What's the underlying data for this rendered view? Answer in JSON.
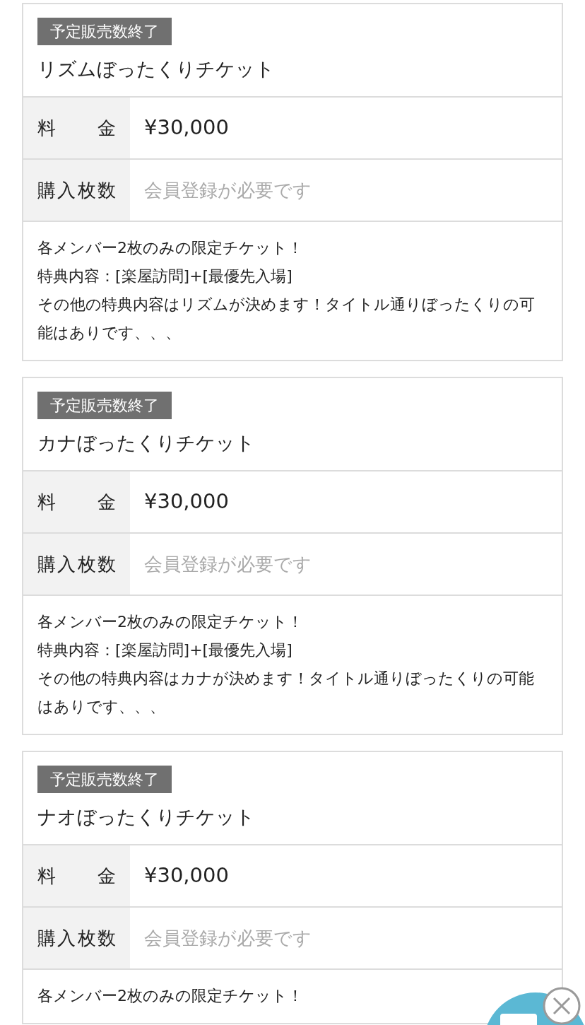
{
  "tickets": [
    {
      "badge": "予定販売数終了",
      "title": "リズムぼったくりチケット",
      "rows": [
        {
          "label": "料　金",
          "value": "¥30,000",
          "kind": "price"
        },
        {
          "label": "購入枚数",
          "value": "会員登録が必要です",
          "kind": "note"
        }
      ],
      "description": [
        "各メンバー2枚のみの限定チケット！",
        "特典内容：[楽屋訪問]+[最優先入場]",
        "その他の特典内容はリズムが決めます！タイトル通りぼったくりの可能はありです、、、"
      ]
    },
    {
      "badge": "予定販売数終了",
      "title": "カナぼったくりチケット",
      "rows": [
        {
          "label": "料　金",
          "value": "¥30,000",
          "kind": "price"
        },
        {
          "label": "購入枚数",
          "value": "会員登録が必要です",
          "kind": "note"
        }
      ],
      "description": [
        "各メンバー2枚のみの限定チケット！",
        "特典内容：[楽屋訪問]+[最優先入場]",
        "その他の特典内容はカナが決めます！タイトル通りぼったくりの可能はありです、、、"
      ]
    },
    {
      "badge": "予定販売数終了",
      "title": "ナオぼったくりチケット",
      "rows": [
        {
          "label": "料　金",
          "value": "¥30,000",
          "kind": "price"
        },
        {
          "label": "購入枚数",
          "value": "会員登録が必要です",
          "kind": "note"
        }
      ],
      "description": [
        "各メンバー2枚のみの限定チケット！"
      ]
    }
  ]
}
